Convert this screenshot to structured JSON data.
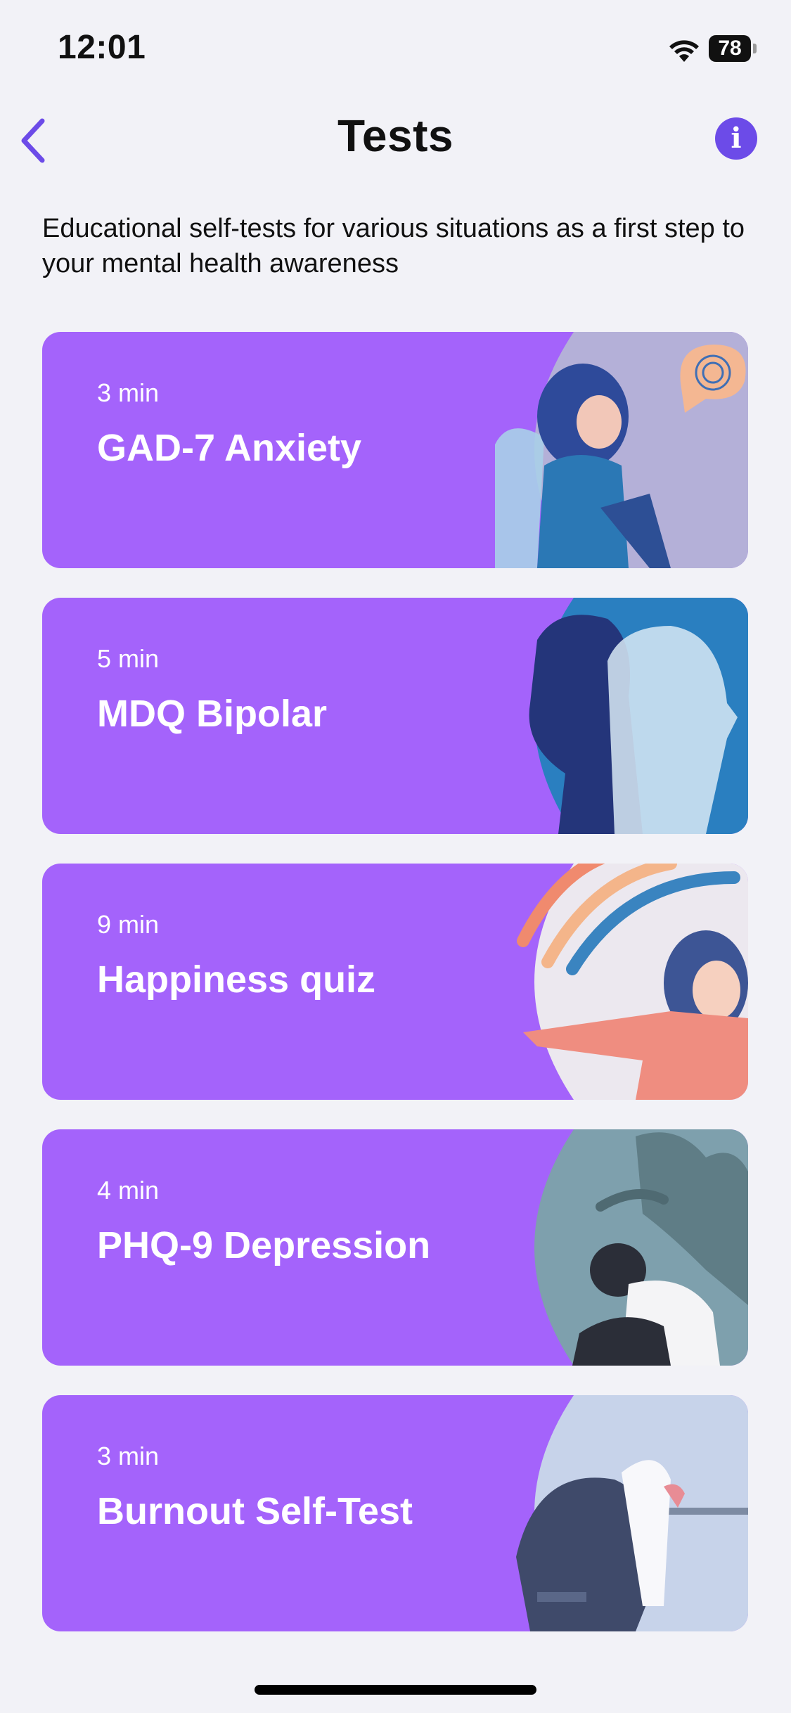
{
  "status_bar": {
    "time": "12:01",
    "battery": "78"
  },
  "nav": {
    "title": "Tests",
    "back_icon": "chevron-left-icon",
    "info_icon": "info-icon",
    "info_glyph": "i"
  },
  "subtitle": "Educational self-tests for various situations as a first step to your mental health awareness",
  "cards": [
    {
      "duration": "3 min",
      "title": "GAD-7 Anxiety"
    },
    {
      "duration": "5 min",
      "title": "MDQ Bipolar"
    },
    {
      "duration": "9 min",
      "title": "Happiness quiz"
    },
    {
      "duration": "4 min",
      "title": "PHQ-9 Depression"
    },
    {
      "duration": "3 min",
      "title": "Burnout Self-Test"
    }
  ],
  "colors": {
    "card_bg": "#a463fb",
    "accent": "#6c4be8",
    "page_bg": "#f2f2f7"
  }
}
